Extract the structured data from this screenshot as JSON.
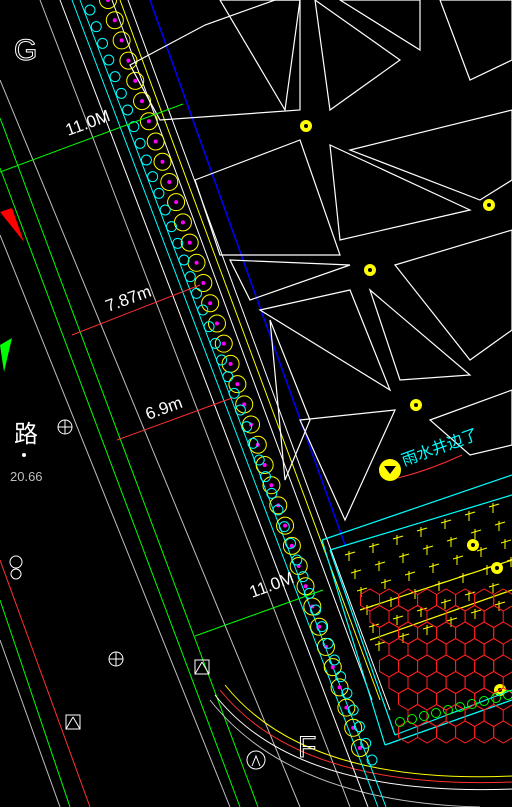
{
  "drawing": {
    "grid_labels": {
      "g": "G",
      "f": "F"
    },
    "dimensions": {
      "top_width": "11.0M",
      "mid_width": "7.87m",
      "lower_width": "6.9m",
      "bottom_width": "11.0M"
    },
    "road": {
      "name_char": "路",
      "elevation": "20.66"
    },
    "annotation": {
      "drain_label": "雨水井边了"
    },
    "colors": {
      "background": "#000000",
      "white_lines": "#ffffff",
      "yellow_lines": "#ffff00",
      "green_lines": "#00ff00",
      "cyan_lines": "#00ffff",
      "blue_line": "#0000ff",
      "red_lines": "#ff0000",
      "magenta_marks": "#ff00ff",
      "red_marker": "#ff0000",
      "green_marker": "#00ff00"
    },
    "symbols": [
      "tree-circle-row",
      "lamp-symbol",
      "crosshair-symbol",
      "box-symbol",
      "north-marker"
    ]
  }
}
